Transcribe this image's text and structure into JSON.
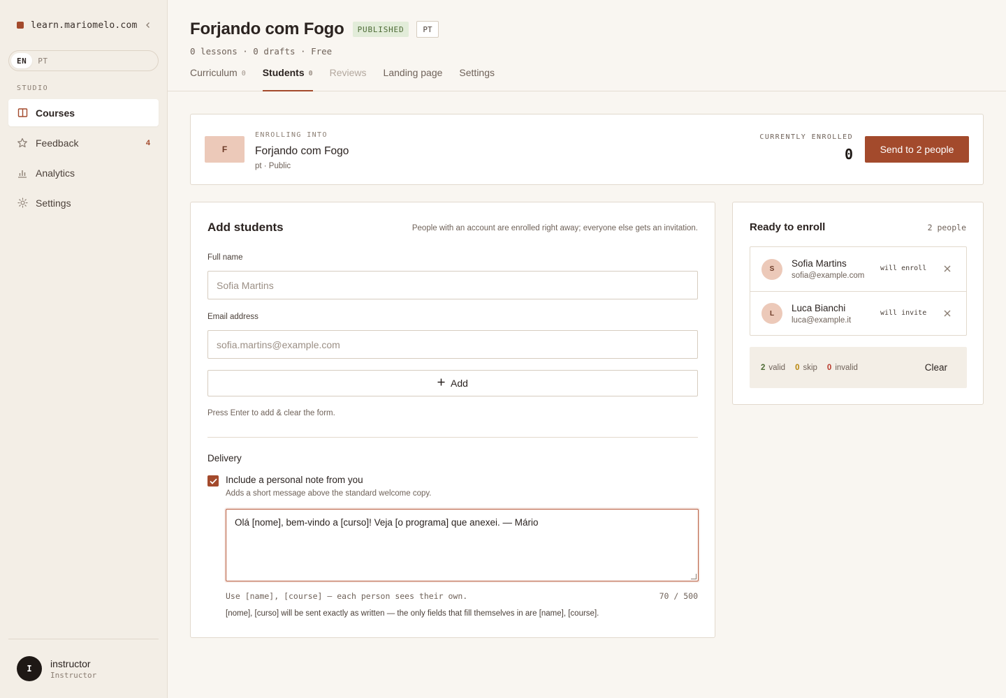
{
  "sidebar": {
    "site_name": "learn.mariomelo.com",
    "lang_options": [
      "EN",
      "PT"
    ],
    "lang_active": "EN",
    "section_label": "STUDIO",
    "items": [
      {
        "label": "Courses",
        "icon": "book-icon",
        "active": true
      },
      {
        "label": "Feedback",
        "icon": "star-icon",
        "badge": "4"
      },
      {
        "label": "Analytics",
        "icon": "bar-chart-icon"
      },
      {
        "label": "Settings",
        "icon": "gear-icon"
      }
    ],
    "user": {
      "initial": "I",
      "name": "instructor",
      "role": "Instructor"
    }
  },
  "header": {
    "title": "Forjando com Fogo",
    "status_badge": "PUBLISHED",
    "lang_badge": "PT",
    "meta": "0 lessons · 0 drafts · Free",
    "tabs": [
      {
        "label": "Curriculum",
        "count": "0"
      },
      {
        "label": "Students",
        "count": "0",
        "active": true
      },
      {
        "label": "Reviews",
        "disabled": true
      },
      {
        "label": "Landing page"
      },
      {
        "label": "Settings"
      }
    ]
  },
  "banner": {
    "thumb_initial": "F",
    "label": "ENROLLING INTO",
    "course": "Forjando com Fogo",
    "sub": "pt · Public",
    "enrolled_label": "CURRENTLY ENROLLED",
    "enrolled_count": "0",
    "send_label": "Send to 2 people"
  },
  "add_students": {
    "title": "Add students",
    "hint": "People with an account are enrolled right away; everyone else gets an invitation.",
    "name_label": "Full name",
    "name_placeholder": "Sofia Martins",
    "email_label": "Email address",
    "email_placeholder": "sofia.martins@example.com",
    "add_label": "Add",
    "press_hint": "Press Enter to add & clear the form.",
    "delivery_label": "Delivery",
    "note_checkbox_label": "Include a personal note from you",
    "note_checkbox_checked": true,
    "note_checkbox_sub": "Adds a short message above the standard welcome copy.",
    "note_value": "Olá [nome], bem-vindo a [curso]! Veja [o programa] que anexei. — Mário",
    "note_hint": "Use [name], [course] — each person sees their own.",
    "note_count": "70 / 500",
    "note_warning": "[nome], [curso] will be sent exactly as written — the only fields that fill themselves in are [name], [course]."
  },
  "ready": {
    "title": "Ready to enroll",
    "count": "2 people",
    "people": [
      {
        "initial": "S",
        "name": "Sofia Martins",
        "email": "sofia@example.com",
        "status": "will enroll"
      },
      {
        "initial": "L",
        "name": "Luca Bianchi",
        "email": "luca@example.it",
        "status": "will invite"
      }
    ],
    "summary": {
      "valid_num": "2",
      "valid_label": "valid",
      "skip_num": "0",
      "skip_label": "skip",
      "invalid_num": "0",
      "invalid_label": "invalid"
    },
    "clear_label": "Clear"
  },
  "colors": {
    "accent": "#a34a2c",
    "valid": "#4d6b35",
    "skip": "#b8860b",
    "invalid": "#b83a2c"
  }
}
